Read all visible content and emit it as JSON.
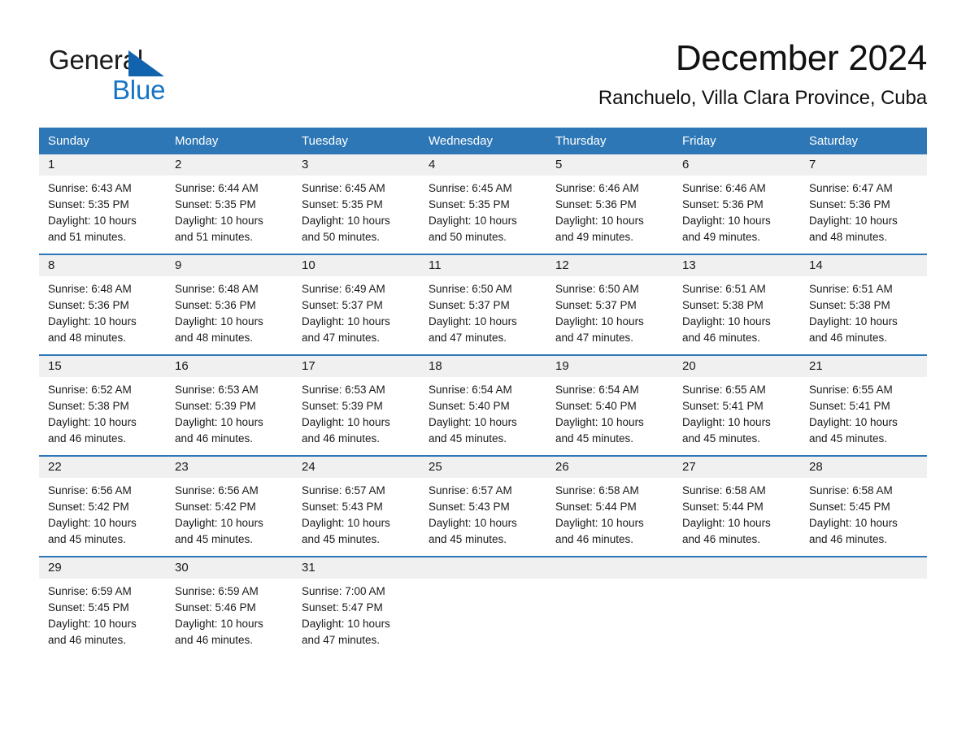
{
  "brand": {
    "word_general": "General",
    "word_blue": "Blue",
    "flag_icon": "triangle-flag-icon"
  },
  "header": {
    "month_title": "December 2024",
    "location": "Ranchuelo, Villa Clara Province, Cuba"
  },
  "colors": {
    "header_blue": "#2e77b6",
    "row_divider_blue": "#2e77b6",
    "daynum_band": "#f0f0f0",
    "brand_blue": "#1575c4",
    "text": "#1a1a1a"
  },
  "weekdays": [
    "Sunday",
    "Monday",
    "Tuesday",
    "Wednesday",
    "Thursday",
    "Friday",
    "Saturday"
  ],
  "weeks": [
    [
      {
        "day": "1",
        "sunrise": "Sunrise: 6:43 AM",
        "sunset": "Sunset: 5:35 PM",
        "daylight_line1": "Daylight: 10 hours",
        "daylight_line2": "and 51 minutes."
      },
      {
        "day": "2",
        "sunrise": "Sunrise: 6:44 AM",
        "sunset": "Sunset: 5:35 PM",
        "daylight_line1": "Daylight: 10 hours",
        "daylight_line2": "and 51 minutes."
      },
      {
        "day": "3",
        "sunrise": "Sunrise: 6:45 AM",
        "sunset": "Sunset: 5:35 PM",
        "daylight_line1": "Daylight: 10 hours",
        "daylight_line2": "and 50 minutes."
      },
      {
        "day": "4",
        "sunrise": "Sunrise: 6:45 AM",
        "sunset": "Sunset: 5:35 PM",
        "daylight_line1": "Daylight: 10 hours",
        "daylight_line2": "and 50 minutes."
      },
      {
        "day": "5",
        "sunrise": "Sunrise: 6:46 AM",
        "sunset": "Sunset: 5:36 PM",
        "daylight_line1": "Daylight: 10 hours",
        "daylight_line2": "and 49 minutes."
      },
      {
        "day": "6",
        "sunrise": "Sunrise: 6:46 AM",
        "sunset": "Sunset: 5:36 PM",
        "daylight_line1": "Daylight: 10 hours",
        "daylight_line2": "and 49 minutes."
      },
      {
        "day": "7",
        "sunrise": "Sunrise: 6:47 AM",
        "sunset": "Sunset: 5:36 PM",
        "daylight_line1": "Daylight: 10 hours",
        "daylight_line2": "and 48 minutes."
      }
    ],
    [
      {
        "day": "8",
        "sunrise": "Sunrise: 6:48 AM",
        "sunset": "Sunset: 5:36 PM",
        "daylight_line1": "Daylight: 10 hours",
        "daylight_line2": "and 48 minutes."
      },
      {
        "day": "9",
        "sunrise": "Sunrise: 6:48 AM",
        "sunset": "Sunset: 5:36 PM",
        "daylight_line1": "Daylight: 10 hours",
        "daylight_line2": "and 48 minutes."
      },
      {
        "day": "10",
        "sunrise": "Sunrise: 6:49 AM",
        "sunset": "Sunset: 5:37 PM",
        "daylight_line1": "Daylight: 10 hours",
        "daylight_line2": "and 47 minutes."
      },
      {
        "day": "11",
        "sunrise": "Sunrise: 6:50 AM",
        "sunset": "Sunset: 5:37 PM",
        "daylight_line1": "Daylight: 10 hours",
        "daylight_line2": "and 47 minutes."
      },
      {
        "day": "12",
        "sunrise": "Sunrise: 6:50 AM",
        "sunset": "Sunset: 5:37 PM",
        "daylight_line1": "Daylight: 10 hours",
        "daylight_line2": "and 47 minutes."
      },
      {
        "day": "13",
        "sunrise": "Sunrise: 6:51 AM",
        "sunset": "Sunset: 5:38 PM",
        "daylight_line1": "Daylight: 10 hours",
        "daylight_line2": "and 46 minutes."
      },
      {
        "day": "14",
        "sunrise": "Sunrise: 6:51 AM",
        "sunset": "Sunset: 5:38 PM",
        "daylight_line1": "Daylight: 10 hours",
        "daylight_line2": "and 46 minutes."
      }
    ],
    [
      {
        "day": "15",
        "sunrise": "Sunrise: 6:52 AM",
        "sunset": "Sunset: 5:38 PM",
        "daylight_line1": "Daylight: 10 hours",
        "daylight_line2": "and 46 minutes."
      },
      {
        "day": "16",
        "sunrise": "Sunrise: 6:53 AM",
        "sunset": "Sunset: 5:39 PM",
        "daylight_line1": "Daylight: 10 hours",
        "daylight_line2": "and 46 minutes."
      },
      {
        "day": "17",
        "sunrise": "Sunrise: 6:53 AM",
        "sunset": "Sunset: 5:39 PM",
        "daylight_line1": "Daylight: 10 hours",
        "daylight_line2": "and 46 minutes."
      },
      {
        "day": "18",
        "sunrise": "Sunrise: 6:54 AM",
        "sunset": "Sunset: 5:40 PM",
        "daylight_line1": "Daylight: 10 hours",
        "daylight_line2": "and 45 minutes."
      },
      {
        "day": "19",
        "sunrise": "Sunrise: 6:54 AM",
        "sunset": "Sunset: 5:40 PM",
        "daylight_line1": "Daylight: 10 hours",
        "daylight_line2": "and 45 minutes."
      },
      {
        "day": "20",
        "sunrise": "Sunrise: 6:55 AM",
        "sunset": "Sunset: 5:41 PM",
        "daylight_line1": "Daylight: 10 hours",
        "daylight_line2": "and 45 minutes."
      },
      {
        "day": "21",
        "sunrise": "Sunrise: 6:55 AM",
        "sunset": "Sunset: 5:41 PM",
        "daylight_line1": "Daylight: 10 hours",
        "daylight_line2": "and 45 minutes."
      }
    ],
    [
      {
        "day": "22",
        "sunrise": "Sunrise: 6:56 AM",
        "sunset": "Sunset: 5:42 PM",
        "daylight_line1": "Daylight: 10 hours",
        "daylight_line2": "and 45 minutes."
      },
      {
        "day": "23",
        "sunrise": "Sunrise: 6:56 AM",
        "sunset": "Sunset: 5:42 PM",
        "daylight_line1": "Daylight: 10 hours",
        "daylight_line2": "and 45 minutes."
      },
      {
        "day": "24",
        "sunrise": "Sunrise: 6:57 AM",
        "sunset": "Sunset: 5:43 PM",
        "daylight_line1": "Daylight: 10 hours",
        "daylight_line2": "and 45 minutes."
      },
      {
        "day": "25",
        "sunrise": "Sunrise: 6:57 AM",
        "sunset": "Sunset: 5:43 PM",
        "daylight_line1": "Daylight: 10 hours",
        "daylight_line2": "and 45 minutes."
      },
      {
        "day": "26",
        "sunrise": "Sunrise: 6:58 AM",
        "sunset": "Sunset: 5:44 PM",
        "daylight_line1": "Daylight: 10 hours",
        "daylight_line2": "and 46 minutes."
      },
      {
        "day": "27",
        "sunrise": "Sunrise: 6:58 AM",
        "sunset": "Sunset: 5:44 PM",
        "daylight_line1": "Daylight: 10 hours",
        "daylight_line2": "and 46 minutes."
      },
      {
        "day": "28",
        "sunrise": "Sunrise: 6:58 AM",
        "sunset": "Sunset: 5:45 PM",
        "daylight_line1": "Daylight: 10 hours",
        "daylight_line2": "and 46 minutes."
      }
    ],
    [
      {
        "day": "29",
        "sunrise": "Sunrise: 6:59 AM",
        "sunset": "Sunset: 5:45 PM",
        "daylight_line1": "Daylight: 10 hours",
        "daylight_line2": "and 46 minutes."
      },
      {
        "day": "30",
        "sunrise": "Sunrise: 6:59 AM",
        "sunset": "Sunset: 5:46 PM",
        "daylight_line1": "Daylight: 10 hours",
        "daylight_line2": "and 46 minutes."
      },
      {
        "day": "31",
        "sunrise": "Sunrise: 7:00 AM",
        "sunset": "Sunset: 5:47 PM",
        "daylight_line1": "Daylight: 10 hours",
        "daylight_line2": "and 47 minutes."
      },
      {
        "day": "",
        "sunrise": "",
        "sunset": "",
        "daylight_line1": "",
        "daylight_line2": ""
      },
      {
        "day": "",
        "sunrise": "",
        "sunset": "",
        "daylight_line1": "",
        "daylight_line2": ""
      },
      {
        "day": "",
        "sunrise": "",
        "sunset": "",
        "daylight_line1": "",
        "daylight_line2": ""
      },
      {
        "day": "",
        "sunrise": "",
        "sunset": "",
        "daylight_line1": "",
        "daylight_line2": ""
      }
    ]
  ]
}
